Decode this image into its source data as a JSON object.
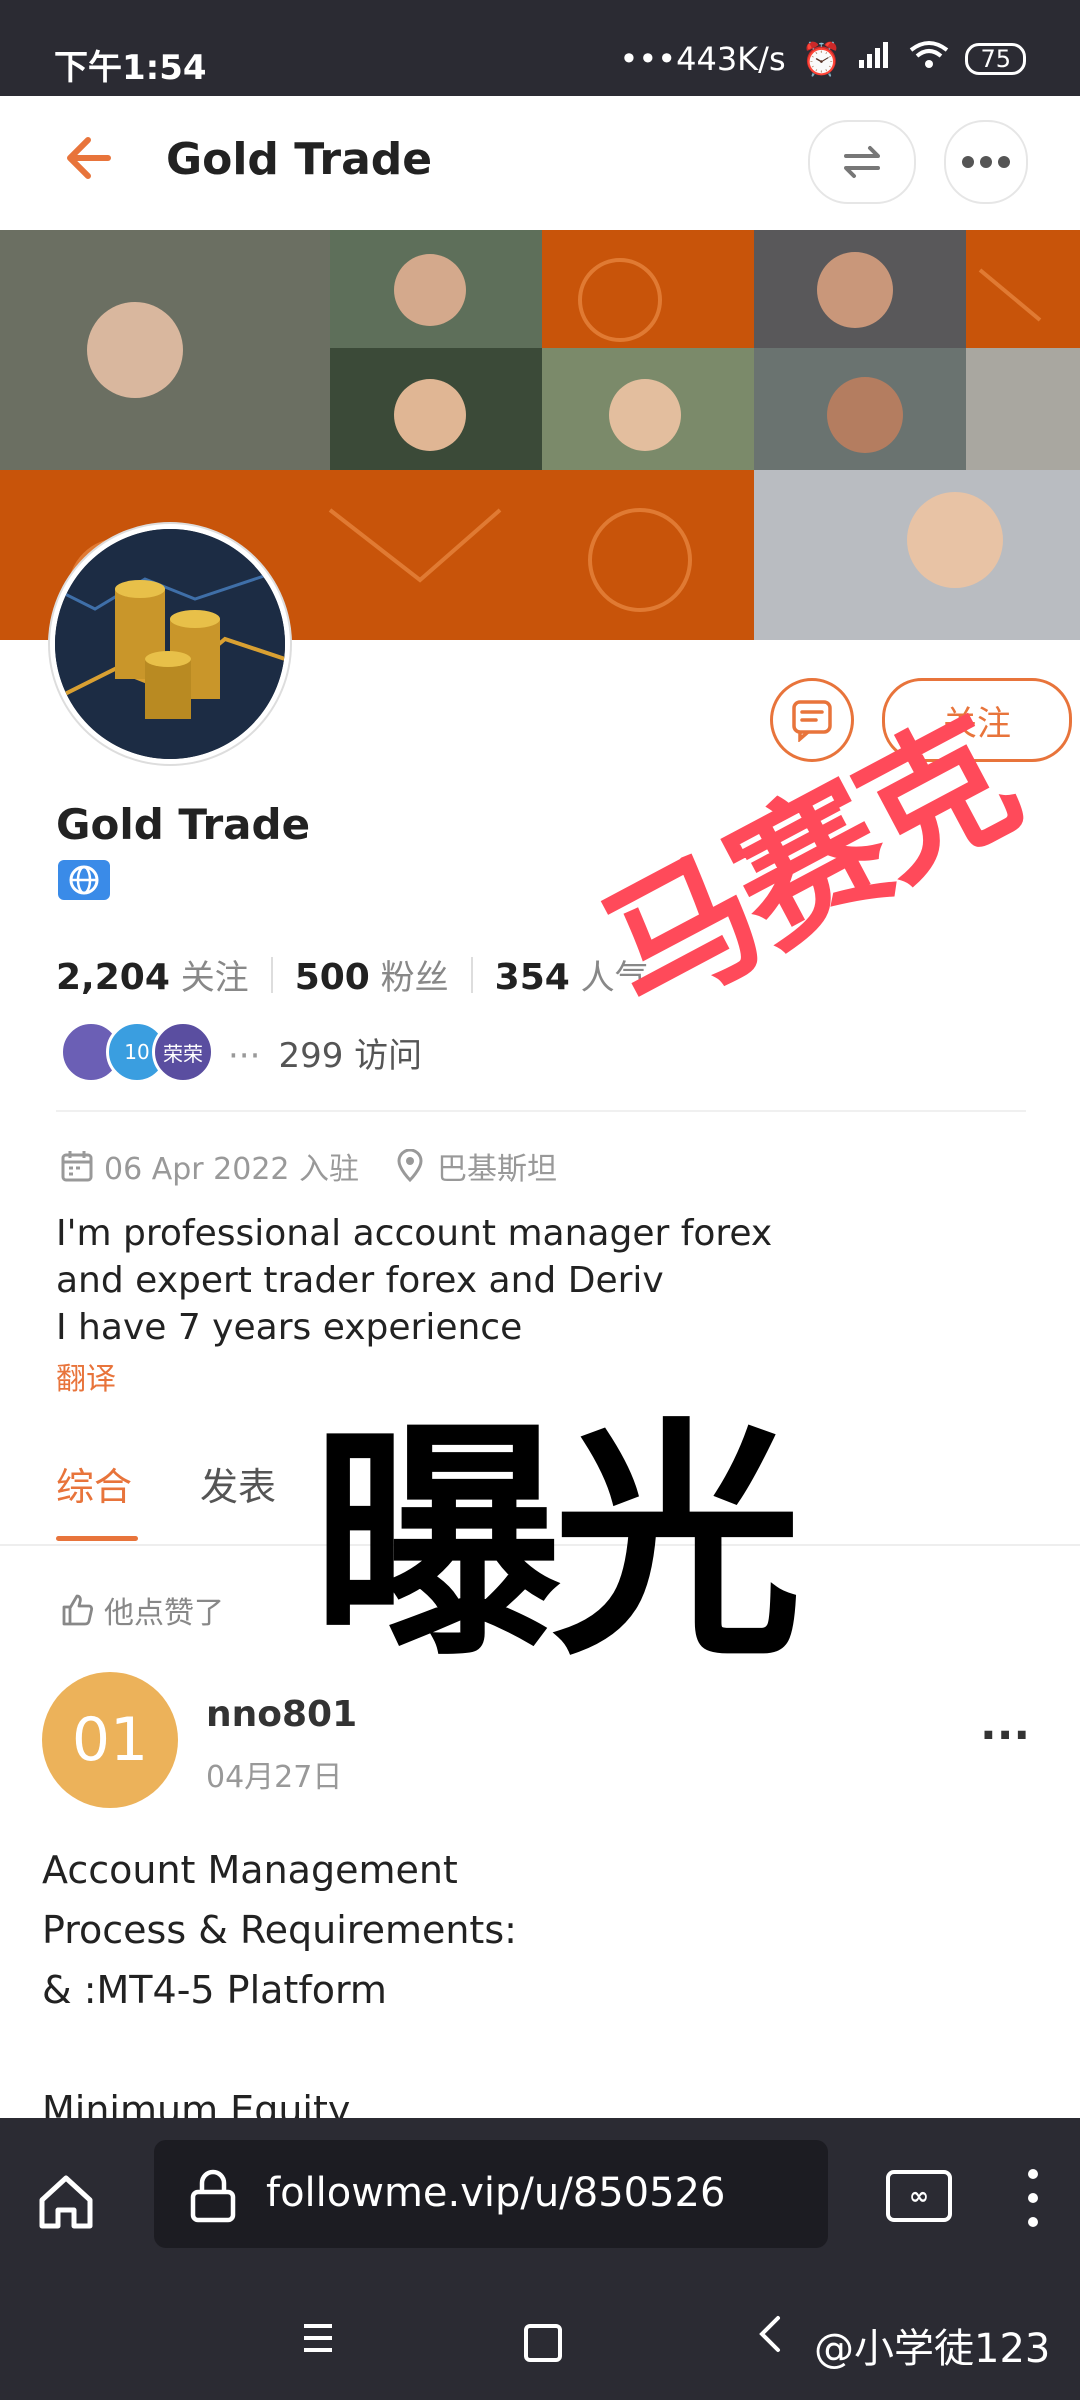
{
  "status_bar": {
    "time": "下午1:54",
    "network_speed": "•••443K/s",
    "battery": "75"
  },
  "header": {
    "title": "Gold Trade",
    "accent_color": "#e8743b"
  },
  "profile": {
    "name": "Gold Trade",
    "follow_label": "关注",
    "stats": {
      "following_count": "2,204",
      "following_label": "关注",
      "followers_count": "500",
      "followers_label": "粉丝",
      "popularity_count": "354",
      "popularity_label": "人气"
    },
    "visitors": {
      "avatar_labels": [
        "",
        "10",
        "荣荣"
      ],
      "ellipsis": "···",
      "visit_text": "299 访问"
    },
    "joined": "06 Apr 2022 入驻",
    "location": "巴基斯坦",
    "bio_lines": [
      "I'm professional account manager forex",
      "and expert trader forex and Deriv",
      "I have 7 years experience"
    ],
    "translate_label": "翻译"
  },
  "tabs": [
    {
      "label": "综合",
      "active": true
    },
    {
      "label": "发表",
      "active": false
    }
  ],
  "feed": {
    "liked_label": "他点赞了",
    "post": {
      "avatar_text": "01",
      "username": "nno801",
      "date": "04月27日",
      "more": "···",
      "text_lines": [
        "Account Management",
        "Process & Requirements:",
        "& :MT4-5 Platform",
        "",
        "Minimum Equity"
      ]
    }
  },
  "overlays": {
    "red_stamp": "马赛克",
    "black_stamp": "曝光"
  },
  "browser": {
    "url": "followme.vip/u/850526",
    "tabs_icon_label": "∞"
  },
  "navbar": {
    "watermark": "@小学徒123"
  }
}
